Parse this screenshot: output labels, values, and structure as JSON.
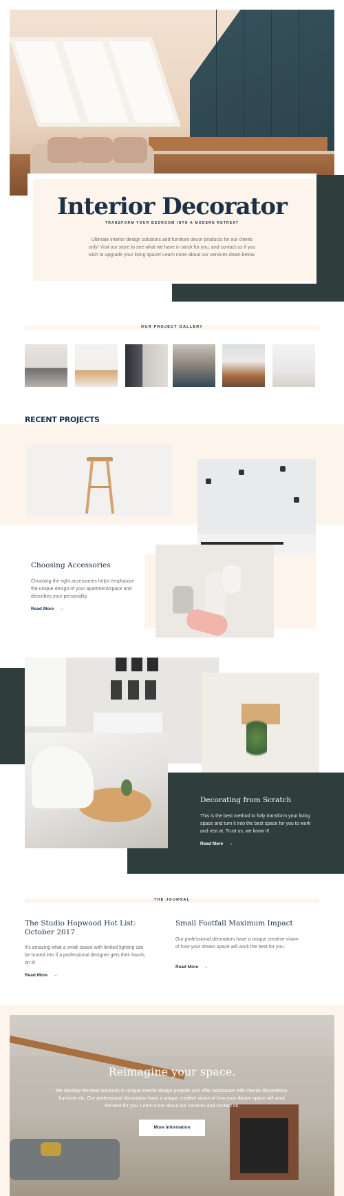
{
  "hero": {
    "title": "Interior Decorator",
    "subtitle": "TRANSFORM YOUR BEDROOM INTO A MODERN RETREAT",
    "description": "Ultimate interior design solutions and furniture decor products for our clients only! Visit our store to see what we have in stock for you, and contact us if you wish to upgrade your living space! Learn more about our services down below."
  },
  "gallery": {
    "label": "OUR PROJECT GALLERY"
  },
  "recent": {
    "heading": "RECENT PROJECTS",
    "project1": {
      "title": "Choosing Accessories",
      "text": "Choosing the right accessories helps emphasize the unique design of your apartment/space and describes your personality.",
      "link": "Read More"
    },
    "project2": {
      "title": "Decorating from Scratch",
      "text": "This is the best method to fully transform your living space and turn it into the best space for you to work and rest at. Trust us, we know it!",
      "link": "Read More"
    }
  },
  "journal": {
    "label": "THE JOURNAL",
    "post1": {
      "title": "The Studio Hopwood Hot List: October 2017",
      "text": "It's amazing what a small space with limited lighting can be turned into if a professional designer gets their hands on it!",
      "link": "Read More"
    },
    "post2": {
      "title": "Small Footfall Maximum Impact",
      "text": "Our professional decorators have a unique creative vision of how your dream space will work the best for you.",
      "link": "Read More"
    }
  },
  "cta": {
    "title": "Reimagine your space.",
    "text": "We develop the best solutions to unique interior design projects and offer assistance with interior decorations, furniture etc. Our professional decorators have a unique creative vision of how your dream space will work the best for you. Learn more about our services and contact us.",
    "button": "More Information"
  },
  "arrow": "→"
}
